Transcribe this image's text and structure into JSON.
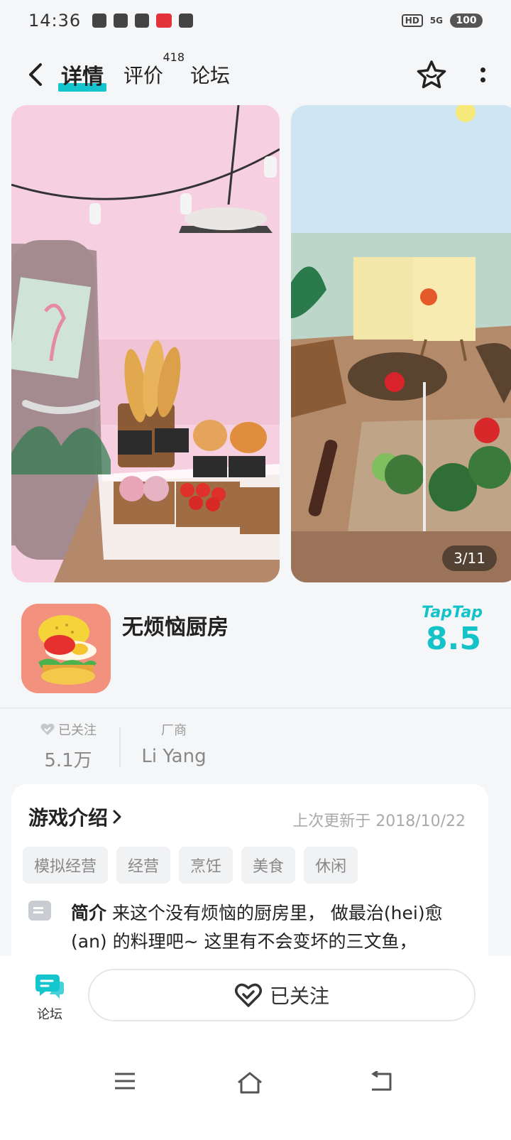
{
  "status_bar": {
    "time": "14:36",
    "hd": "HD",
    "signal": "5G",
    "battery": "100"
  },
  "header": {
    "tabs": [
      {
        "label": "详情",
        "active": true
      },
      {
        "label": "评价",
        "badge": "418"
      },
      {
        "label": "论坛"
      }
    ]
  },
  "carousel": {
    "indicator": "3/11"
  },
  "app": {
    "name": "无烦恼厨房",
    "rating_brand": "TapTap",
    "rating_score": "8.5"
  },
  "stats": {
    "followers_label": "已关注",
    "followers_value": "5.1万",
    "vendor_label": "厂商",
    "vendor_value": "Li Yang"
  },
  "intro": {
    "title": "游戏介绍",
    "updated": "上次更新于 2018/10/22",
    "tags": [
      "模拟经营",
      "经营",
      "烹饪",
      "美食",
      "休闲"
    ],
    "desc_label": "简介",
    "desc_text": " 来这个没有烦恼的厨房里， 做最治(hei)愈(an) 的料理吧~ 这里有不会变坏的三文鱼，"
  },
  "bottom": {
    "forum_label": "论坛",
    "follow_label": "已关注"
  },
  "colors": {
    "accent": "#15c5ce",
    "rating": "#14c3c8"
  }
}
